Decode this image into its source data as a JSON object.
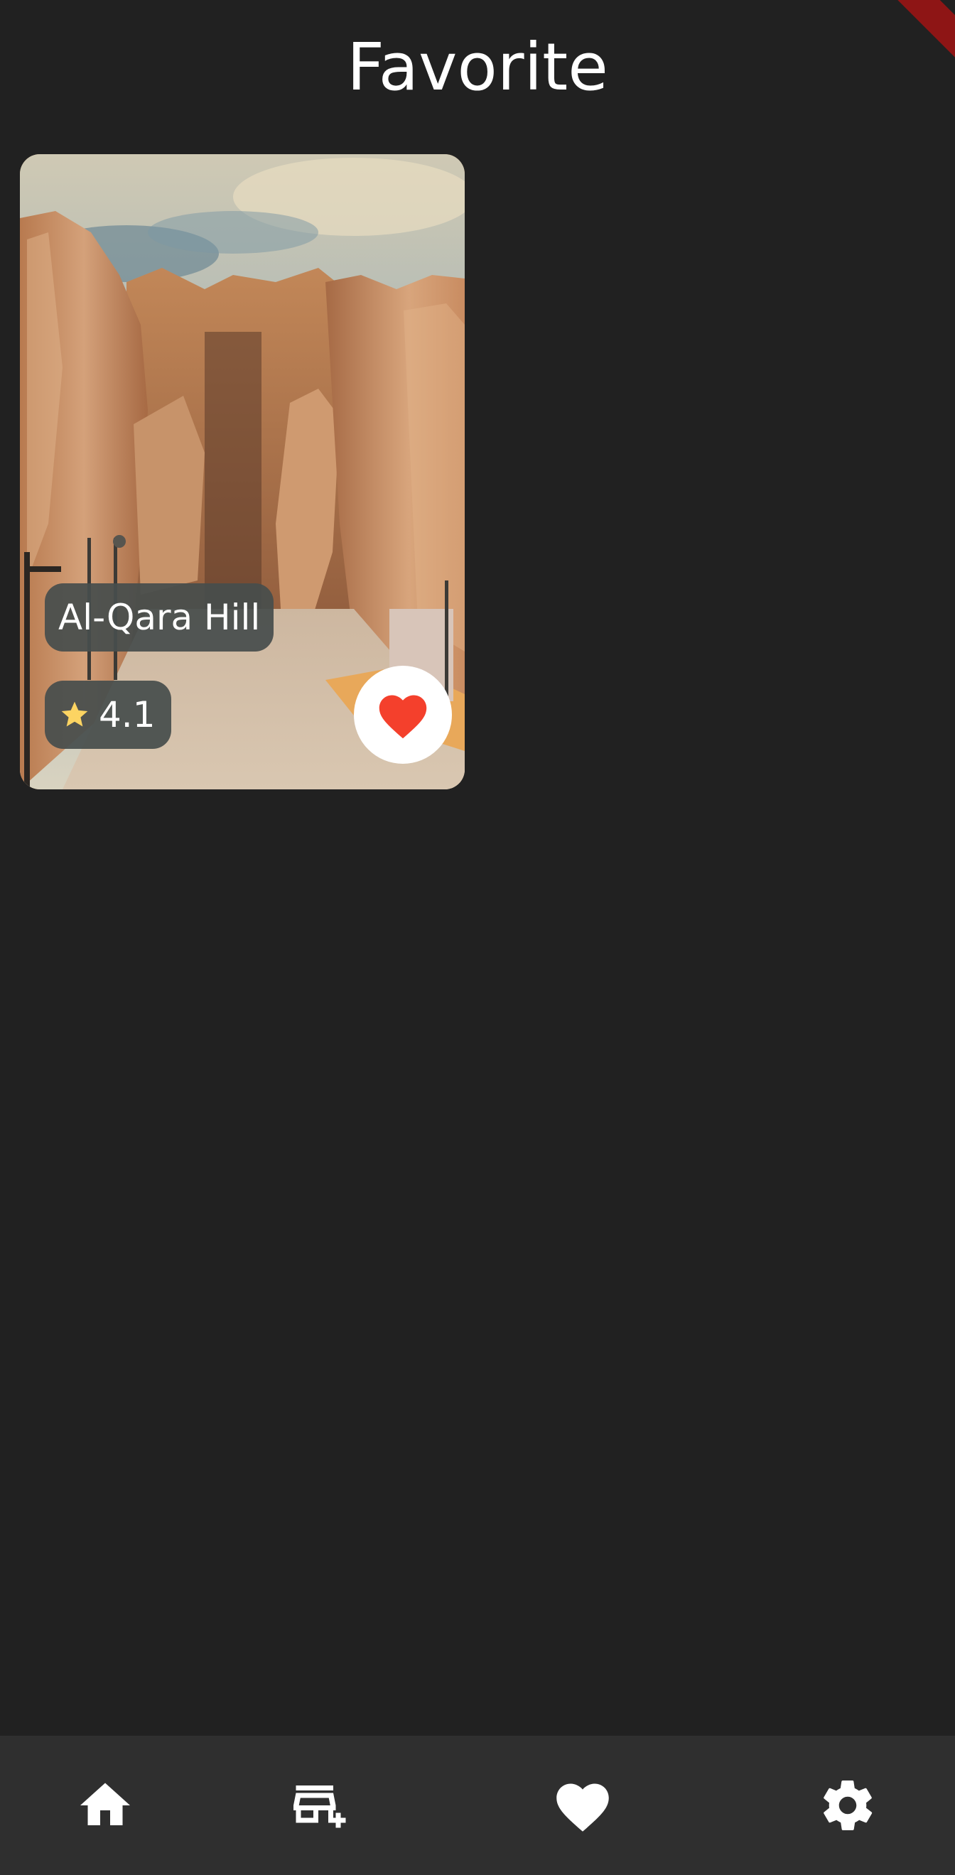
{
  "header": {
    "title": "Favorite"
  },
  "favorites": [
    {
      "name": "Al-Qara Hill",
      "rating": "4.1",
      "image_icon": "rock-canyon-photo",
      "favorite_icon": "heart-icon",
      "favorite_color": "#f4402c"
    }
  ],
  "colors": {
    "background": "#212121",
    "nav_background": "#2f2f2f",
    "chip_background": "#474d4c",
    "star": "#fcd462",
    "debug_banner": "#8e1515"
  },
  "bottom_nav": {
    "items": [
      {
        "icon": "home-icon"
      },
      {
        "icon": "add-business-icon"
      },
      {
        "icon": "heart-icon"
      },
      {
        "icon": "gear-icon"
      }
    ]
  }
}
